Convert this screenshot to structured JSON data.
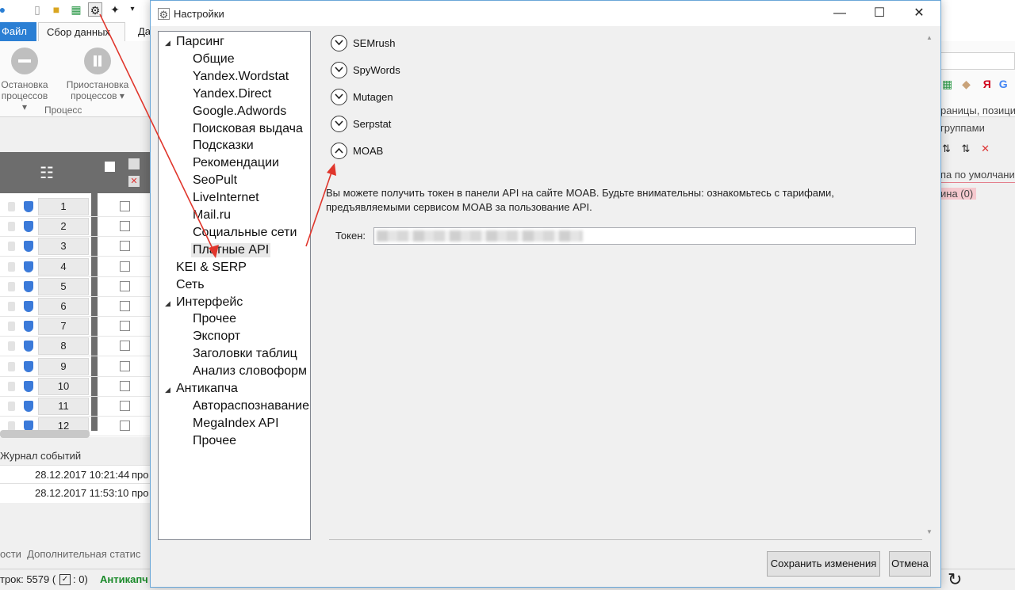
{
  "background": {
    "qat_icons": [
      "app-icon",
      "new-file-icon",
      "folder-icon",
      "xls-icon",
      "gear-icon",
      "magic-wand-icon",
      "dropdown-icon"
    ],
    "ribbon_tabs": [
      "Файл",
      "Сбор данных",
      "Да"
    ],
    "ribbon_buttons": [
      {
        "line1": "Остановка",
        "line2": "процессов ▾"
      },
      {
        "line1": "Приостановка",
        "line2": "процессов ▾"
      }
    ],
    "ribbon_group": "Процесс",
    "grid_rows": [
      "1",
      "2",
      "3",
      "4",
      "5",
      "6",
      "7",
      "8",
      "9",
      "10",
      "11",
      "12"
    ],
    "log_title": "Журнал событий",
    "log_rows": [
      {
        "time": "28.12.2017 10:21:44",
        "text": "про"
      },
      {
        "time": "28.12.2017 11:53:10",
        "text": "про"
      }
    ],
    "bottom_tabs": "ости  Дополнительная статис",
    "status_rows": "трок: 5579 (",
    "status_count": ": 0)",
    "status_anticaptcha": "Антикапч",
    "right_panel": {
      "line1": "раницы, позици",
      "line2": "группами",
      "line3": "па по умолчани",
      "line4": "ина (0)"
    }
  },
  "dialog": {
    "title": "Настройки",
    "tree": [
      {
        "label": "Парсинг",
        "level": 0,
        "expanded": true
      },
      {
        "label": "Общие",
        "level": 1
      },
      {
        "label": "Yandex.Wordstat",
        "level": 1
      },
      {
        "label": "Yandex.Direct",
        "level": 1
      },
      {
        "label": "Google.Adwords",
        "level": 1
      },
      {
        "label": "Поисковая выдача",
        "level": 1
      },
      {
        "label": "Подсказки",
        "level": 1
      },
      {
        "label": "Рекомендации",
        "level": 1
      },
      {
        "label": "SeoPult",
        "level": 1
      },
      {
        "label": "LiveInternet",
        "level": 1
      },
      {
        "label": "Mail.ru",
        "level": 1
      },
      {
        "label": "Социальные сети",
        "level": 1
      },
      {
        "label": "Платные API",
        "level": 1,
        "selected": true
      },
      {
        "label": "KEI & SERP",
        "level": 0
      },
      {
        "label": "Сеть",
        "level": 0
      },
      {
        "label": "Интерфейс",
        "level": 0,
        "expanded": true
      },
      {
        "label": "Прочее",
        "level": 1
      },
      {
        "label": "Экспорт",
        "level": 1
      },
      {
        "label": "Заголовки таблиц",
        "level": 1
      },
      {
        "label": "Анализ словоформ",
        "level": 1
      },
      {
        "label": "Антикапча",
        "level": 0,
        "expanded": true
      },
      {
        "label": "Автораспознавание",
        "level": 1
      },
      {
        "label": "MegaIndex API",
        "level": 1
      },
      {
        "label": "Прочее",
        "level": 1
      }
    ],
    "expanders": [
      {
        "label": "SEMrush",
        "expanded": false
      },
      {
        "label": "SpyWords",
        "expanded": false
      },
      {
        "label": "Mutagen",
        "expanded": false
      },
      {
        "label": "Serpstat",
        "expanded": false
      },
      {
        "label": "MOAB",
        "expanded": true
      }
    ],
    "moab_info_line1": "Вы можете получить токен в панели API на сайте MOAB. Будьте внимательны: ознакомьтесь с тарифами,",
    "moab_info_line2": "предъявляемыми сервисом MOAB за пользование API.",
    "token_label": "Токен:",
    "save_label": "Сохранить изменения",
    "cancel_label": "Отмена",
    "annotation_color": "#e0362c"
  }
}
